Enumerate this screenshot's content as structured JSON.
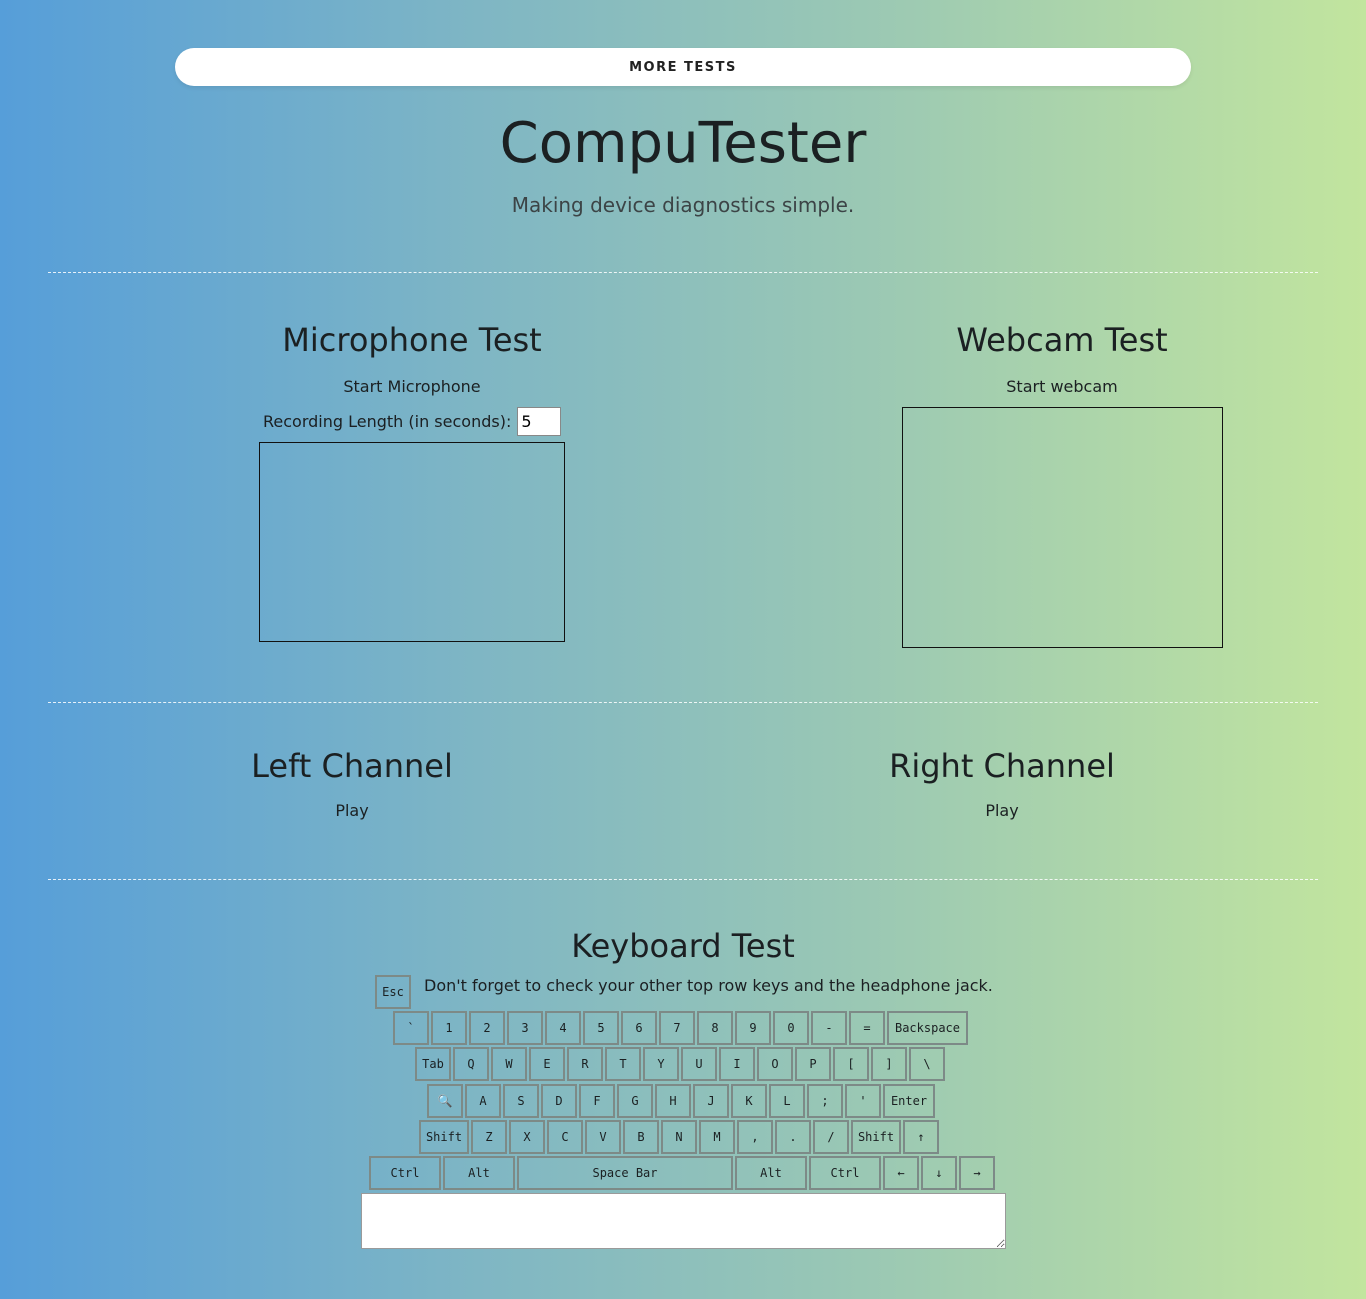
{
  "nav": {
    "more_tests": "MORE TESTS"
  },
  "header": {
    "title": "CompuTester",
    "subtitle": "Making device diagnostics simple."
  },
  "microphone": {
    "title": "Microphone Test",
    "start": "Start Microphone",
    "recording_label": "Recording Length (in seconds):",
    "recording_value": "5"
  },
  "webcam": {
    "title": "Webcam Test",
    "start": "Start webcam"
  },
  "audio": {
    "left_title": "Left Channel",
    "left_play": "Play",
    "right_title": "Right Channel",
    "right_play": "Play"
  },
  "keyboard": {
    "title": "Keyboard Test",
    "note": "Don't forget to check your other top row keys and the headphone jack.",
    "esc": "Esc",
    "rows": [
      [
        "`",
        "1",
        "2",
        "3",
        "4",
        "5",
        "6",
        "7",
        "8",
        "9",
        "0",
        "-",
        "=",
        "Backspace"
      ],
      [
        "Tab",
        "Q",
        "W",
        "E",
        "R",
        "T",
        "Y",
        "U",
        "I",
        "O",
        "P",
        "[",
        "]",
        "\\"
      ],
      [
        "🔍",
        "A",
        "S",
        "D",
        "F",
        "G",
        "H",
        "J",
        "K",
        "L",
        ";",
        "'",
        "Enter"
      ],
      [
        "Shift",
        "Z",
        "X",
        "C",
        "V",
        "B",
        "N",
        "M",
        ",",
        ".",
        "/",
        "Shift",
        "↑"
      ],
      [
        "Ctrl",
        "Alt",
        "Space Bar",
        "Alt",
        "Ctrl",
        "←",
        "↓",
        "→"
      ]
    ]
  }
}
